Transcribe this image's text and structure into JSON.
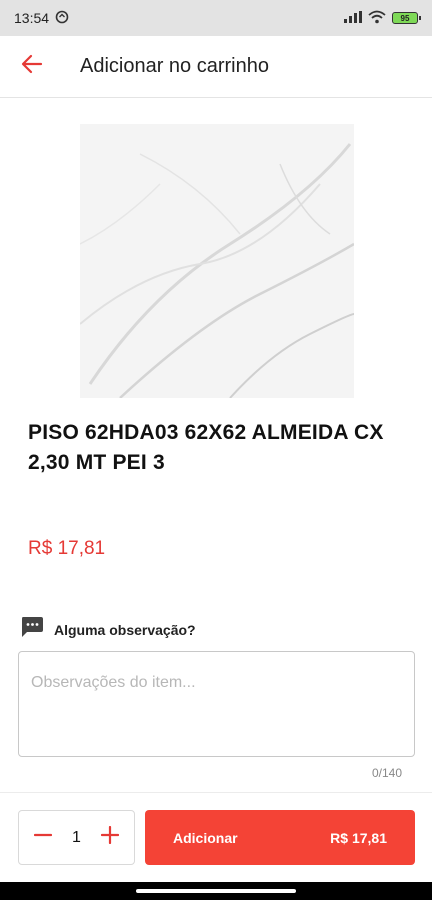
{
  "status_bar": {
    "time": "13:54",
    "battery": "95"
  },
  "app_bar": {
    "title": "Adicionar no carrinho",
    "back_icon": "arrow-left-icon"
  },
  "product": {
    "name": "PISO 62HDA03 62X62 ALMEIDA CX 2,30 MT PEI 3",
    "price": "R$ 17,81",
    "image": "white-marble-tile-image"
  },
  "observation": {
    "label": "Alguma observação?",
    "placeholder": "Observações do item...",
    "value": "",
    "counter": "0/140",
    "icon": "chat-bubble-icon"
  },
  "quantity": {
    "value": "1",
    "minus_icon": "minus-icon",
    "plus_icon": "plus-icon"
  },
  "add_button": {
    "label": "Adicionar",
    "price": "R$ 17,81"
  },
  "colors": {
    "accent": "#f44336",
    "price": "#e53935",
    "status_bar": "#e3e3e3"
  }
}
